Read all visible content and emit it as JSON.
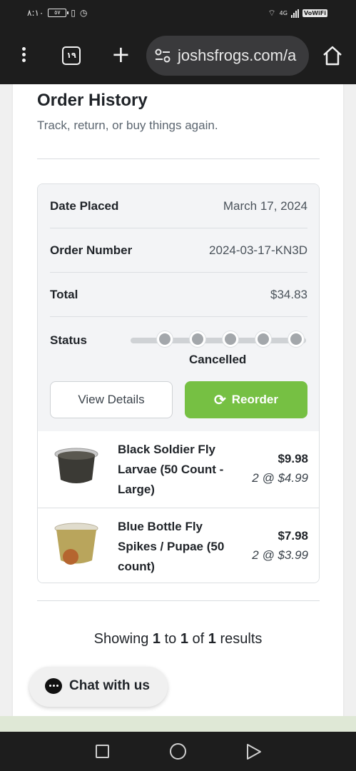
{
  "status_bar": {
    "time": "٨:١٠",
    "battery": "٥٧",
    "network": "4G",
    "vowifi": "VoWiFi"
  },
  "browser": {
    "tab_count": "١٩",
    "url": "joshsfrogs.com/a",
    "icons": [
      "menu-dots-icon",
      "tabs-icon",
      "plus-icon",
      "site-settings-icon",
      "home-icon"
    ]
  },
  "page": {
    "title": "Order History",
    "subtitle": "Track, return, or buy things again.",
    "order": {
      "date_label": "Date Placed",
      "date_value": "March 17, 2024",
      "number_label": "Order Number",
      "number_value": "2024-03-17-KN3D",
      "total_label": "Total",
      "total_value": "$34.83",
      "status_label": "Status",
      "status_value": "Cancelled",
      "status_steps": 5,
      "view_details_label": "View Details",
      "reorder_label": "Reorder",
      "items": [
        {
          "name": "Black Soldier Fly Larvae (50 Count - Large)",
          "price": "$9.98",
          "each": "2 @ $4.99"
        },
        {
          "name": "Blue Bottle Fly Spikes / Pupae (50 count)",
          "price": "$7.98",
          "each": "2 @ $3.99"
        }
      ]
    },
    "results": {
      "prefix": "Showing",
      "from": "1",
      "to_word": "to",
      "to": "1",
      "of_word": "of",
      "total": "1",
      "suffix": "results"
    },
    "chat_label": "Chat with us"
  },
  "colors": {
    "accent_green": "#76c043",
    "status_dot": "#a3a7ab",
    "chrome_bg": "#1d1d1d"
  }
}
